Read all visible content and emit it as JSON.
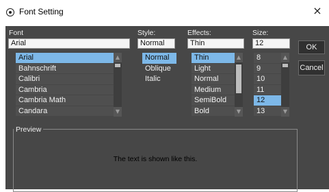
{
  "window": {
    "title": "Font Setting",
    "close_symbol": "×"
  },
  "font": {
    "label": "Font",
    "value": "Arial",
    "items": [
      "Arial",
      "Bahnschrift",
      "Calibri",
      "Cambria",
      "Cambria Math",
      "Candara"
    ],
    "selected": "Arial"
  },
  "style": {
    "label": "Style:",
    "value": "Normal",
    "items": [
      "Normal",
      "Oblique",
      "Italic"
    ],
    "selected": "Normal"
  },
  "effects": {
    "label": "Effects:",
    "value": "Thin",
    "items": [
      "Thin",
      "Light",
      "Normal",
      "Medium",
      "SemiBold",
      "Bold"
    ],
    "selected": "Thin"
  },
  "size": {
    "label": "Size:",
    "value": "12",
    "items": [
      "8",
      "9",
      "10",
      "11",
      "12",
      "13"
    ],
    "selected": "12"
  },
  "buttons": {
    "ok": "OK",
    "cancel": "Cancel"
  },
  "preview": {
    "label": "Preview",
    "sample_text": "The text is shown like this."
  },
  "colors": {
    "selection": "#7db8e8",
    "background": "#474747",
    "list_background": "#4f4f4f"
  }
}
